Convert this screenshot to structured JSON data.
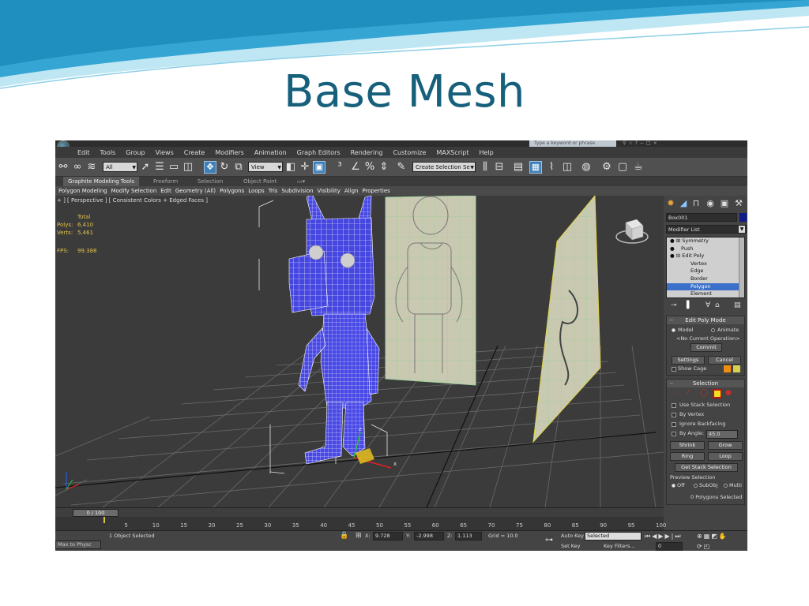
{
  "slide": {
    "title": "Base Mesh",
    "colors": {
      "title": "#17607c",
      "wave_dark": "#1f8fbf",
      "wave_light": "#bfe6f3"
    }
  },
  "app": {
    "search_placeholder": "Type a keyword or phrase",
    "menu": [
      "Edit",
      "Tools",
      "Group",
      "Views",
      "Create",
      "Modifiers",
      "Animation",
      "Graph Editors",
      "Rendering",
      "Customize",
      "MAXScript",
      "Help"
    ],
    "toolbar": {
      "filter_value": "All",
      "coord_system": "View",
      "selection_set_placeholder": "Create Selection Se"
    },
    "ribbon_tabs": [
      "Graphite Modeling Tools",
      "Freeform",
      "Selection",
      "Object Paint"
    ],
    "ribbon_items": [
      "Polygon Modeling",
      "Modify Selection",
      "Edit",
      "Geometry (All)",
      "Polygons",
      "Loops",
      "Tris",
      "Subdivision",
      "Visibility",
      "Align",
      "Properties"
    ],
    "viewport": {
      "label": "+ ] [ Perspective ] [ Consistent Colors + Edged Faces ]",
      "stats": {
        "total_label": "Total",
        "polys_label": "Polys:",
        "polys_value": "6,410",
        "verts_label": "Verts:",
        "verts_value": "5,461",
        "fps_label": "FPS:",
        "fps_value": "99.388"
      },
      "colors": {
        "mesh": "#4a4ae8",
        "wire": "#ffffff",
        "grid": "#6a6a6a",
        "plane": "#c9c9b2"
      }
    },
    "command_panel": {
      "object_name": "Box001",
      "modifier_list": "Modifier List",
      "stack": [
        "Symmetry",
        "Push",
        "Edit Poly",
        "Vertex",
        "Edge",
        "Border",
        "Polygon",
        "Element"
      ],
      "stack_selected": "Polygon",
      "edit_poly_mode": {
        "title": "Edit Poly Mode",
        "model": "Model",
        "animate": "Animate",
        "current_op": "<No Current Operation>",
        "commit": "Commit",
        "settings": "Settings",
        "cancel": "Cancel",
        "show_cage": "Show Cage"
      },
      "selection": {
        "title": "Selection",
        "use_stack": "Use Stack Selection",
        "by_vertex": "By Vertex",
        "ignore_backfacing": "Ignore Backfacing",
        "by_angle": "By Angle:",
        "by_angle_value": "45.0",
        "shrink": "Shrink",
        "grow": "Grow",
        "ring": "Ring",
        "loop": "Loop",
        "get_stack": "Get Stack Selection",
        "preview_label": "Preview Selection",
        "off": "Off",
        "subobj": "SubObj",
        "multi": "Multi",
        "count": "0 Polygons Selected"
      }
    },
    "timeline": {
      "frame_display": "0 / 100",
      "ticks": [
        "5",
        "10",
        "15",
        "20",
        "25",
        "30",
        "35",
        "40",
        "45",
        "50",
        "55",
        "60",
        "65",
        "70",
        "75",
        "80",
        "85",
        "90",
        "95",
        "100"
      ]
    },
    "status": {
      "left_script": "Max to Physc",
      "selected_count": "1 Object Selected",
      "x_label": "X:",
      "x_value": "9.728",
      "y_label": "Y:",
      "y_value": "-2.998",
      "z_label": "Z:",
      "z_value": "1.113",
      "grid": "Grid = 10.0",
      "auto_key": "Auto Key",
      "auto_key_value": "Selected",
      "set_key": "Set Key",
      "key_filters": "Key Filters...",
      "frame_field": "0"
    }
  }
}
